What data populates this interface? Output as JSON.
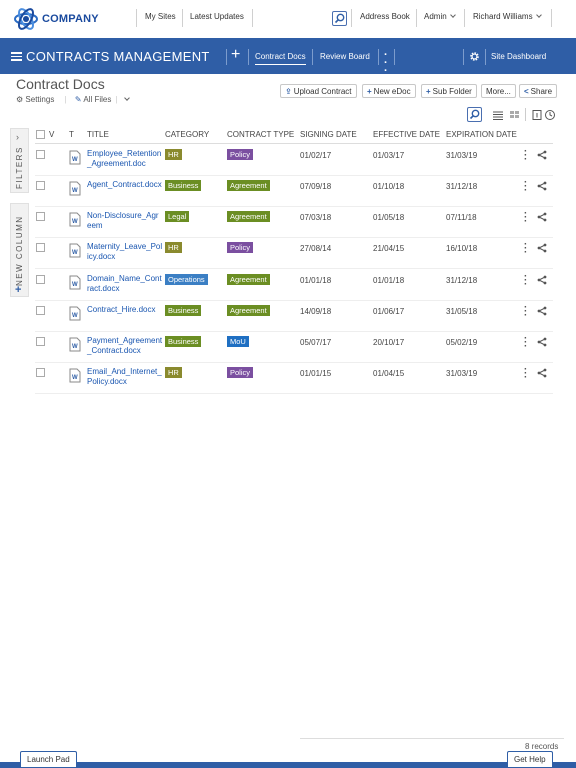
{
  "header": {
    "logo_text": "COMPANY",
    "nav": [
      "My Sites",
      "Latest Updates"
    ],
    "address_book": "Address Book",
    "admin": "Admin",
    "user": "Richard Williams"
  },
  "appbar": {
    "title": "CONTRACTS MANAGEMENT",
    "tabs": [
      "Contract Docs",
      "Review Board"
    ],
    "site_dashboard": "Site Dashboard"
  },
  "page": {
    "title": "Contract Docs",
    "settings": "Settings",
    "all_files": "All Files"
  },
  "toolbar": {
    "upload": "Upload Contract",
    "new_edoc": "New eDoc",
    "sub_folder": "Sub Folder",
    "more": "More...",
    "share": "Share"
  },
  "side": {
    "filters": "FILTERS",
    "new_column": "NEW COLUMN"
  },
  "table": {
    "columns": [
      "V",
      "T",
      "TITLE",
      "CATEGORY",
      "CONTRACT TYPE",
      "SIGNING DATE",
      "EFFECTIVE DATE",
      "EXPIRATION DATE"
    ],
    "rows": [
      {
        "title": "Employee_Retention_Agreement.doc",
        "category": "HR",
        "type": "Policy",
        "signing": "01/02/17",
        "effective": "01/03/17",
        "expiration": "31/03/19"
      },
      {
        "title": "Agent_Contract.docx",
        "category": "Business",
        "type": "Agreement",
        "signing": "07/09/18",
        "effective": "01/10/18",
        "expiration": "31/12/18"
      },
      {
        "title": "Non-Disclosure_Agreem",
        "category": "Legal",
        "type": "Agreement",
        "signing": "07/03/18",
        "effective": "01/05/18",
        "expiration": "07/11/18"
      },
      {
        "title": "Maternity_Leave_Policy.docx",
        "category": "HR",
        "type": "Policy",
        "signing": "27/08/14",
        "effective": "21/04/15",
        "expiration": "16/10/18"
      },
      {
        "title": "Domain_Name_Contract.docx",
        "category": "Operations",
        "type": "Agreement",
        "signing": "01/01/18",
        "effective": "01/01/18",
        "expiration": "31/12/18"
      },
      {
        "title": "Contract_Hire.docx",
        "category": "Business",
        "type": "Agreement",
        "signing": "14/09/18",
        "effective": "01/06/17",
        "expiration": "31/05/18"
      },
      {
        "title": "Payment_Agreement_Contract.docx",
        "category": "Business",
        "type": "MoU",
        "signing": "05/07/17",
        "effective": "20/10/17",
        "expiration": "05/02/19"
      },
      {
        "title": "Email_And_Internet_Policy.docx",
        "category": "HR",
        "type": "Policy",
        "signing": "01/01/15",
        "effective": "01/04/15",
        "expiration": "31/03/19"
      }
    ]
  },
  "footer": {
    "records": "8 records",
    "launch_pad": "Launch Pad",
    "get_help": "Get Help"
  },
  "colors": {
    "brand_blue": "#2f5ea6",
    "link": "#1a56b0",
    "HR": "#8a8a2e",
    "Business": "#6b8e23",
    "Legal": "#6b8e23",
    "Operations": "#3b7fc4",
    "Policy": "#7b4fa0",
    "Agreement": "#6b8e23",
    "MoU": "#1f6fc2"
  }
}
